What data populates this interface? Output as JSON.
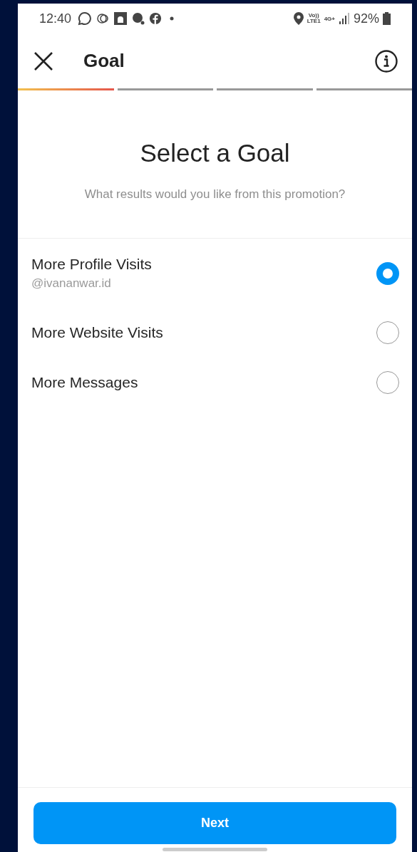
{
  "status_bar": {
    "time": "12:40",
    "volte_top": "Vo))",
    "volte_bottom": "LTE1",
    "network": "4G+",
    "battery": "92%"
  },
  "header": {
    "title": "Goal"
  },
  "steps": [
    {
      "done": true
    },
    {
      "done": false
    },
    {
      "done": false
    },
    {
      "done": false
    }
  ],
  "heading": "Select a Goal",
  "subtitle": "What results would you like from this promotion?",
  "options": [
    {
      "label": "More Profile Visits",
      "detail": "@ivananwar.id",
      "selected": true
    },
    {
      "label": "More Website Visits",
      "selected": false
    },
    {
      "label": "More Messages",
      "selected": false
    }
  ],
  "next_button": "Next"
}
